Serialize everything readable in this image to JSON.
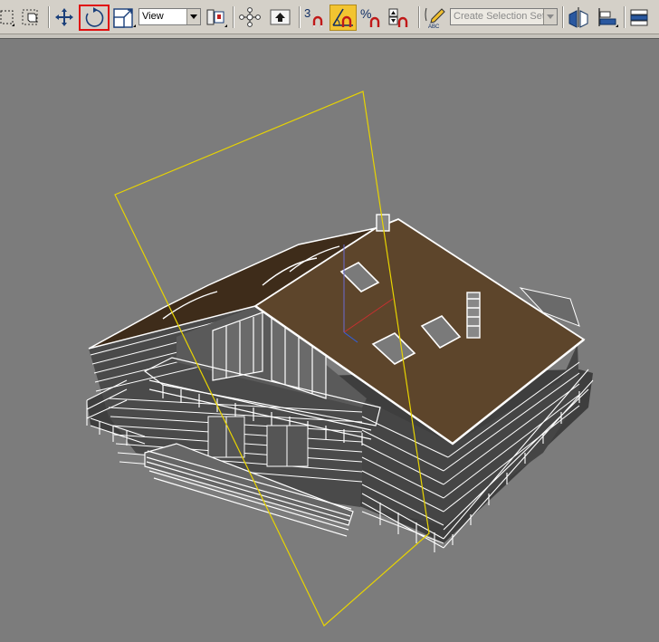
{
  "app": {
    "name": "3ds Max viewport"
  },
  "toolbar": {
    "items": [
      {
        "id": "select-region",
        "icon": "select-region-icon"
      },
      {
        "id": "window-crossing",
        "icon": "window-crossing-icon"
      },
      {
        "id": "select-move",
        "icon": "move-icon"
      },
      {
        "id": "select-rotate",
        "icon": "rotate-icon",
        "state": "active"
      },
      {
        "id": "select-scale",
        "icon": "scale-icon"
      },
      {
        "id": "pivot-center",
        "icon": "pivot-center-icon"
      },
      {
        "id": "select-manipulate",
        "icon": "manipulate-icon"
      },
      {
        "id": "keyboard-shortcut",
        "icon": "keyboard-override-icon"
      },
      {
        "id": "snaps-3d",
        "icon": "snap-icon",
        "label": "3"
      },
      {
        "id": "angle-snap",
        "icon": "angle-snap-icon",
        "state": "active"
      },
      {
        "id": "percent-snap",
        "icon": "percent-snap-icon",
        "label": "%"
      },
      {
        "id": "spinner-snap",
        "icon": "spinner-snap-icon"
      },
      {
        "id": "edit-named-selections",
        "icon": "edit-named-selection-icon",
        "label": "ABC"
      },
      {
        "id": "mirror",
        "icon": "mirror-icon"
      },
      {
        "id": "align",
        "icon": "align-icon"
      },
      {
        "id": "layer-manager",
        "icon": "layer-manager-icon"
      }
    ],
    "reference_coordinate_system": {
      "value": "View"
    },
    "named_selection_set": {
      "placeholder": "Create Selection Set"
    }
  },
  "colors": {
    "toolbar_bg": "#d4d0c8",
    "viewport_bg": "#7c7c7c",
    "roof": "#5d452b",
    "wireframe": "#ffffff",
    "gizmo": "#e8d400",
    "active_red": "#e01010",
    "active_yellow": "#f2c431"
  }
}
